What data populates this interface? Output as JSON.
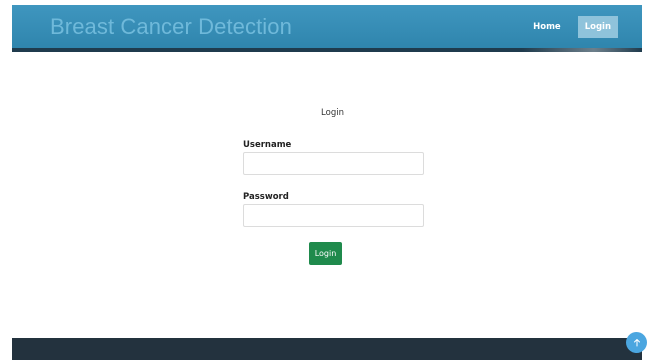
{
  "header": {
    "brand": "Breast Cancer Detection",
    "nav": [
      {
        "label": "Home",
        "active": false
      },
      {
        "label": "Login",
        "active": true
      }
    ]
  },
  "form": {
    "title": "Login",
    "username_label": "Username",
    "username_value": "",
    "password_label": "Password",
    "password_value": "",
    "submit_label": "Login"
  },
  "scroll_top": {
    "icon": "arrow-up-icon"
  },
  "colors": {
    "header": "#3f96bf",
    "header_border": "#1f3b4d",
    "brand_text": "#6fb9da",
    "active_nav": "#8fc3db",
    "submit_button": "#1f8a4c",
    "footer": "#23323e",
    "scroll_top": "#4ba6e0"
  }
}
